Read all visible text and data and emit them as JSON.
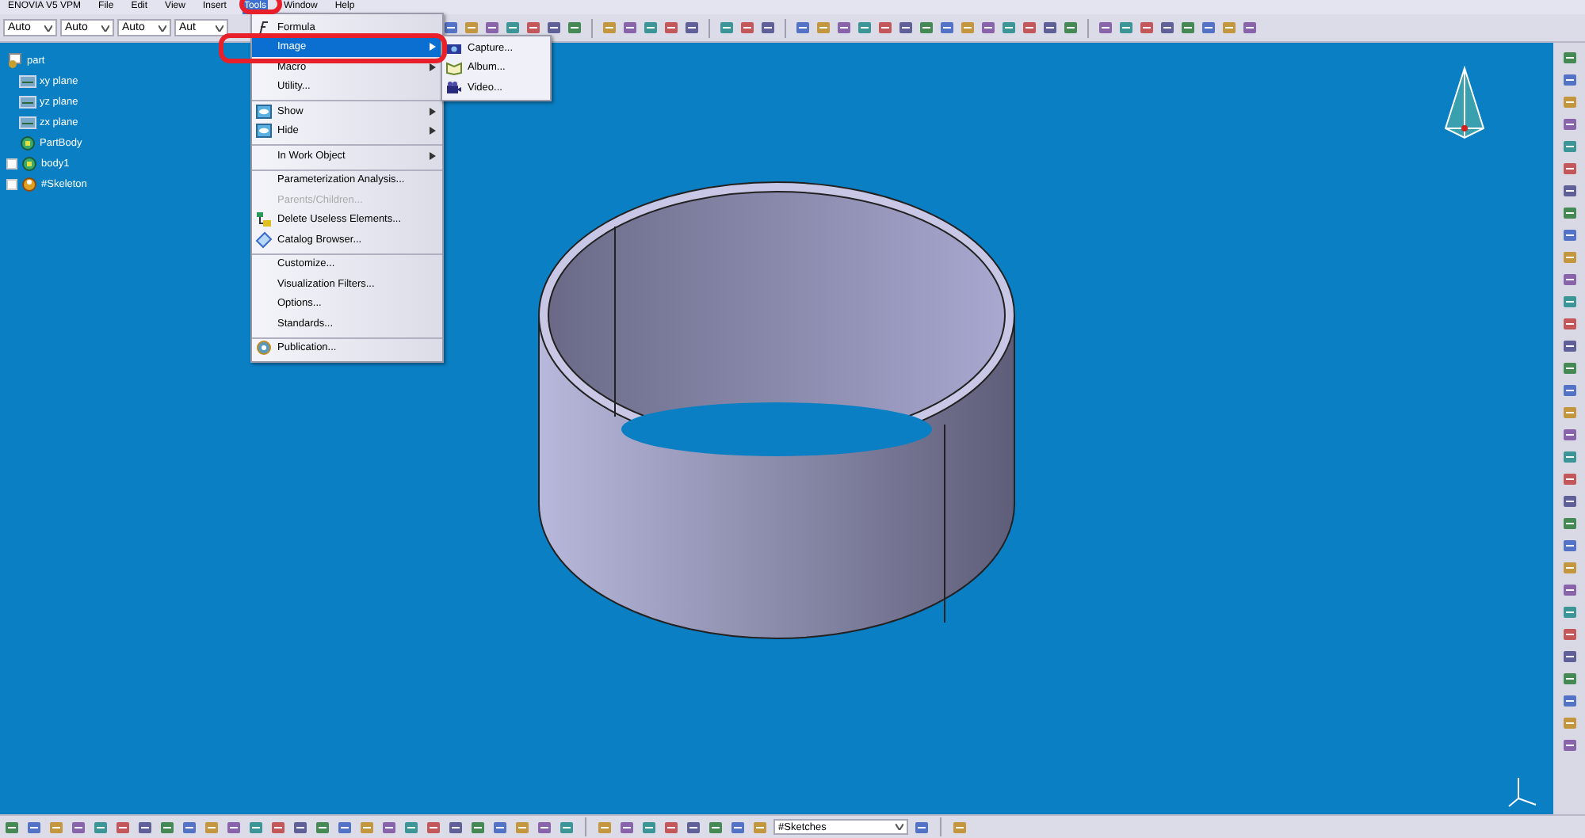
{
  "menubar": [
    {
      "label": "ENOVIA V5 VPM",
      "selected": false
    },
    {
      "label": "File",
      "selected": false
    },
    {
      "label": "Edit",
      "selected": false
    },
    {
      "label": "View",
      "selected": false
    },
    {
      "label": "Insert",
      "selected": false
    },
    {
      "label": "Tools",
      "selected": true
    },
    {
      "label": "Window",
      "selected": false
    },
    {
      "label": "Help",
      "selected": false
    }
  ],
  "toolbar": {
    "dropdowns": [
      "Auto",
      "Auto",
      "Auto",
      "Aut"
    ]
  },
  "tree": {
    "label": "part",
    "kind": "part",
    "children": [
      {
        "label": "xy plane",
        "kind": "plane",
        "expanded": false
      },
      {
        "label": "yz plane",
        "kind": "plane",
        "expanded": false
      },
      {
        "label": "zx plane",
        "kind": "plane",
        "expanded": false
      },
      {
        "label": "PartBody",
        "kind": "body",
        "expanded": false
      },
      {
        "label": "body1",
        "kind": "body",
        "expanded": true
      },
      {
        "label": "#Skeleton",
        "kind": "skeleton",
        "expanded": true
      }
    ]
  },
  "tools_menu": [
    {
      "label": "Formula",
      "selected": false,
      "disabled": false,
      "submenu": false,
      "separator_before": false,
      "kind": "formula"
    },
    {
      "label": "Image",
      "selected": true,
      "disabled": false,
      "submenu": true,
      "separator_before": false,
      "kind": "plain"
    },
    {
      "label": "Macro",
      "selected": false,
      "disabled": false,
      "submenu": true,
      "separator_before": false,
      "kind": "plain"
    },
    {
      "label": "Utility...",
      "selected": false,
      "disabled": false,
      "submenu": false,
      "separator_before": false,
      "kind": "plain"
    },
    {
      "label": "Show",
      "selected": false,
      "disabled": false,
      "submenu": true,
      "separator_before": true,
      "kind": "show"
    },
    {
      "label": "Hide",
      "selected": false,
      "disabled": false,
      "submenu": true,
      "separator_before": false,
      "kind": "show"
    },
    {
      "label": "In Work Object",
      "selected": false,
      "disabled": false,
      "submenu": true,
      "separator_before": true,
      "kind": "plain"
    },
    {
      "label": "Parameterization Analysis...",
      "selected": false,
      "disabled": false,
      "submenu": false,
      "separator_before": true,
      "kind": "plain"
    },
    {
      "label": "Parents/Children...",
      "selected": false,
      "disabled": true,
      "submenu": false,
      "separator_before": false,
      "kind": "plain"
    },
    {
      "label": "Delete Useless Elements...",
      "selected": false,
      "disabled": false,
      "submenu": false,
      "separator_before": false,
      "kind": "delete"
    },
    {
      "label": "Catalog Browser...",
      "selected": false,
      "disabled": false,
      "submenu": false,
      "separator_before": false,
      "kind": "catalog"
    },
    {
      "label": "Customize...",
      "selected": false,
      "disabled": false,
      "submenu": false,
      "separator_before": true,
      "kind": "plain"
    },
    {
      "label": "Visualization Filters...",
      "selected": false,
      "disabled": false,
      "submenu": false,
      "separator_before": false,
      "kind": "plain"
    },
    {
      "label": "Options...",
      "selected": false,
      "disabled": false,
      "submenu": false,
      "separator_before": false,
      "kind": "plain"
    },
    {
      "label": "Standards...",
      "selected": false,
      "disabled": false,
      "submenu": false,
      "separator_before": false,
      "kind": "plain"
    },
    {
      "label": "Publication...",
      "selected": false,
      "disabled": false,
      "submenu": false,
      "separator_before": true,
      "kind": "publication"
    }
  ],
  "image_submenu": [
    {
      "label": "Capture...",
      "kind": "camera"
    },
    {
      "label": "Album...",
      "kind": "album"
    },
    {
      "label": "Video...",
      "kind": "video"
    }
  ],
  "bottom_toolbar": {
    "layer_select": "#Sketches"
  }
}
